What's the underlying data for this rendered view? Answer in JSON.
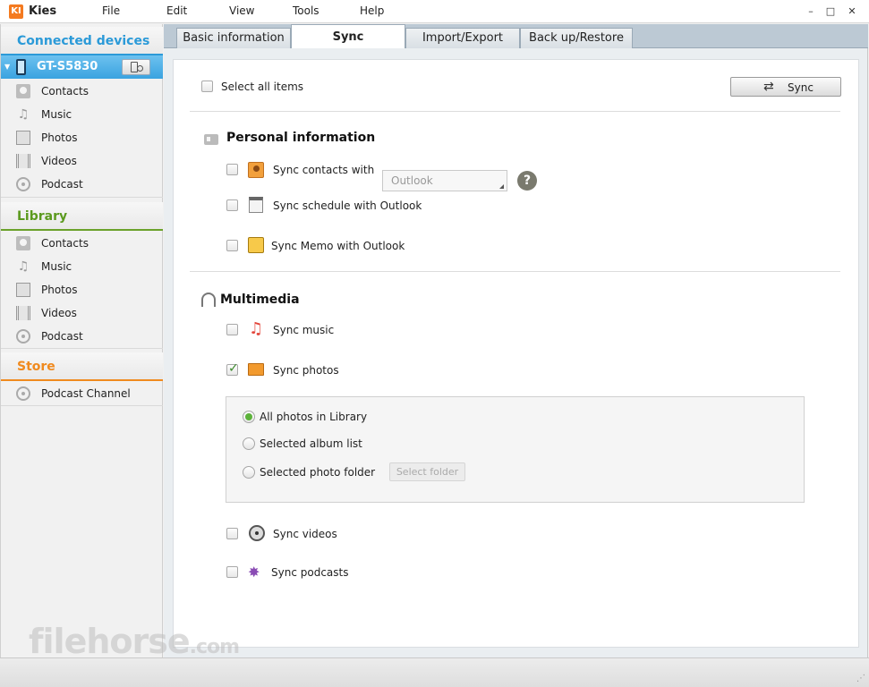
{
  "app": {
    "logo_text": "KI",
    "title": "Kies",
    "menu": [
      "File",
      "Edit",
      "View",
      "Tools",
      "Help"
    ],
    "window_controls": {
      "minimize": "–",
      "maximize": "□",
      "close": "✕"
    }
  },
  "sidebar": {
    "connected_header": "Connected devices",
    "device_name": "GT-S5830",
    "device_items": [
      "Contacts",
      "Music",
      "Photos",
      "Videos",
      "Podcast"
    ],
    "library_header": "Library",
    "library_items": [
      "Contacts",
      "Music",
      "Photos",
      "Videos",
      "Podcast"
    ],
    "store_header": "Store",
    "store_items": [
      "Podcast Channel"
    ]
  },
  "tabs": [
    {
      "label": "Basic information",
      "active": false
    },
    {
      "label": "Sync",
      "active": true
    },
    {
      "label": "Import/Export",
      "active": false
    },
    {
      "label": "Back up/Restore",
      "active": false
    }
  ],
  "sync": {
    "select_all_label": "Select all items",
    "select_all_checked": false,
    "sync_button_label": "Sync",
    "personal": {
      "title": "Personal information",
      "items": [
        {
          "label": "Sync contacts with",
          "checked": false,
          "icon": "contacts-icon"
        },
        {
          "label": "Sync schedule with Outlook",
          "checked": false,
          "icon": "calendar-icon"
        },
        {
          "label": "Sync Memo with Outlook",
          "checked": false,
          "icon": "memo-icon"
        }
      ],
      "contacts_target": "Outlook",
      "help_glyph": "?"
    },
    "multimedia": {
      "title": "Multimedia",
      "items": [
        {
          "label": "Sync music",
          "checked": false,
          "icon": "music-icon"
        },
        {
          "label": "Sync photos",
          "checked": true,
          "icon": "photos-icon"
        },
        {
          "label": "Sync videos",
          "checked": false,
          "icon": "film-reel-icon"
        },
        {
          "label": "Sync podcasts",
          "checked": false,
          "icon": "podcast-icon"
        }
      ],
      "photo_options": [
        {
          "label": "All photos in Library",
          "selected": true
        },
        {
          "label": "Selected album list",
          "selected": false
        },
        {
          "label": "Selected photo folder",
          "selected": false
        }
      ],
      "select_folder_label": "Select folder"
    }
  },
  "watermark": {
    "text": "filehorse",
    "suffix": ".com"
  },
  "colors": {
    "accent_blue": "#2b9ad8",
    "library_green": "#5b9a1e",
    "store_orange": "#f08a1e",
    "device_row": "#3aa3e0"
  }
}
